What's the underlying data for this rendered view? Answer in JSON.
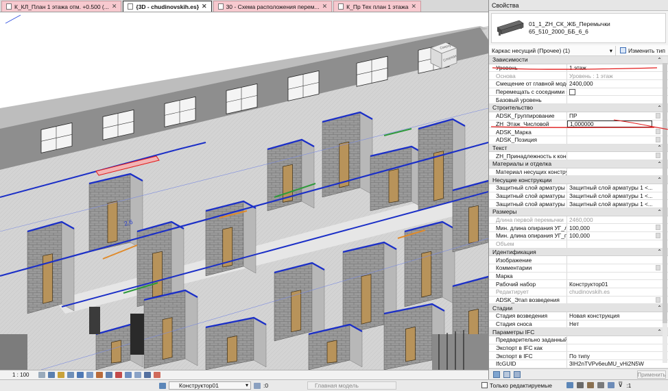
{
  "tabs": [
    {
      "label": "К_КЛ_План 1 этажа  отм. +0.500 (...",
      "active": false
    },
    {
      "label": "{3D - chudinovskih.es}",
      "active": true
    },
    {
      "label": "30 - Схема расположения перем...",
      "active": false
    },
    {
      "label": "К_Пр Тех план 1 этажа",
      "active": false
    }
  ],
  "viewport": {
    "viewcube_labels": [
      "Сверху",
      "Спереди"
    ],
    "annotation": "2,6"
  },
  "viewbar": {
    "scale": "1 : 100"
  },
  "statusbar": {
    "workset": "Конструктор01",
    "workset_count": ":0",
    "model": "Главная модель",
    "editable_only": "Только редактируемые",
    "filter_count": ":1"
  },
  "properties": {
    "title": "Свойства",
    "type_name_1": "01_1_ZH_СК_ЖБ_Перемычки",
    "type_name_2": "65_510_2000_ББ_6_6",
    "selector": "Каркас несущий (Прочее) (1)",
    "edit_type": "Изменить тип",
    "apply": "Применить",
    "categories": [
      {
        "name": "Зависимости",
        "rows": [
          {
            "k": "Уровень",
            "v": "1 этаж"
          },
          {
            "k": "Основа",
            "v": "Уровень : 1 этаж",
            "dim": true
          },
          {
            "k": "Смещение от главной модели",
            "v": "2400,000"
          },
          {
            "k": "Перемещать с соседними эл...",
            "v": "",
            "check": true
          },
          {
            "k": "Базовый уровень",
            "v": ""
          }
        ]
      },
      {
        "name": "Строительство",
        "rows": [
          {
            "k": "ADSK_Группирование",
            "v": "ПР",
            "sq": true
          },
          {
            "k": "ZH_Этаж_Числовой",
            "v": "1,000000",
            "input": true
          },
          {
            "k": "ADSK_Марка",
            "v": "",
            "sq": true
          },
          {
            "k": "ADSK_Позиция",
            "v": "",
            "sq": true
          }
        ]
      },
      {
        "name": "Текст",
        "rows": [
          {
            "k": "ZH_Принадлежность к конст...",
            "v": "",
            "sq": true
          }
        ]
      },
      {
        "name": "Материалы и отделка",
        "rows": [
          {
            "k": "Материал несущих конструк...",
            "v": ""
          }
        ]
      },
      {
        "name": "Несущие конструкции",
        "rows": [
          {
            "k": "Защитный слой арматуры - ...",
            "v": "Защитный слой арматуры 1 <..."
          },
          {
            "k": "Защитный слой арматуры - ...",
            "v": "Защитный слой арматуры 1 <..."
          },
          {
            "k": "Защитный слой арматуры - ...",
            "v": "Защитный слой арматуры 1 <..."
          }
        ]
      },
      {
        "name": "Размеры",
        "rows": [
          {
            "k": "Длина первой перемычки",
            "v": "2460,000",
            "dim": true
          },
          {
            "k": "Мин. длина опирания УГ_левая",
            "v": "100,000",
            "sq": true
          },
          {
            "k": "Мин. длина опирания УГ_пра...",
            "v": "100,000",
            "sq": true
          },
          {
            "k": "Объем",
            "v": "",
            "dim": true
          }
        ]
      },
      {
        "name": "Идентификация",
        "rows": [
          {
            "k": "Изображение",
            "v": ""
          },
          {
            "k": "Комментарии",
            "v": "",
            "sq": true
          },
          {
            "k": "Марка",
            "v": ""
          },
          {
            "k": "Рабочий набор",
            "v": "Конструктор01"
          },
          {
            "k": "Редактирует",
            "v": "chudinovskih.es",
            "dim": true
          },
          {
            "k": "ADSK_Этап возведения",
            "v": "",
            "sq": true
          }
        ]
      },
      {
        "name": "Стадии",
        "rows": [
          {
            "k": "Стадия возведения",
            "v": "Новая конструкция"
          },
          {
            "k": "Стадия сноса",
            "v": "Нет"
          }
        ]
      },
      {
        "name": "Параметры IFC",
        "rows": [
          {
            "k": "Предварительно заданный ти...",
            "v": ""
          },
          {
            "k": "Экспорт в IFC как",
            "v": ""
          },
          {
            "k": "Экспорт в IFC",
            "v": "По типу"
          },
          {
            "k": "IfcGUID",
            "v": "3IH2nTVPv6euMU_vHi2N5W"
          }
        ]
      }
    ]
  },
  "colors": {
    "wall_block": "#8f8f8f",
    "wall_edge": "#1b2fc7",
    "floor": "#c8c8c8",
    "door": "#b8935a",
    "accent_orange": "#e08a2a",
    "markup_red": "#e21b1b",
    "tab_inactive": "#f7c9cf"
  },
  "icons": [
    "document-icon",
    "close-icon",
    "viewcube-icon",
    "beam-thumbnail-icon",
    "edit-type-icon",
    "checkbox-icon",
    "filter-icon",
    "workset-icon"
  ]
}
